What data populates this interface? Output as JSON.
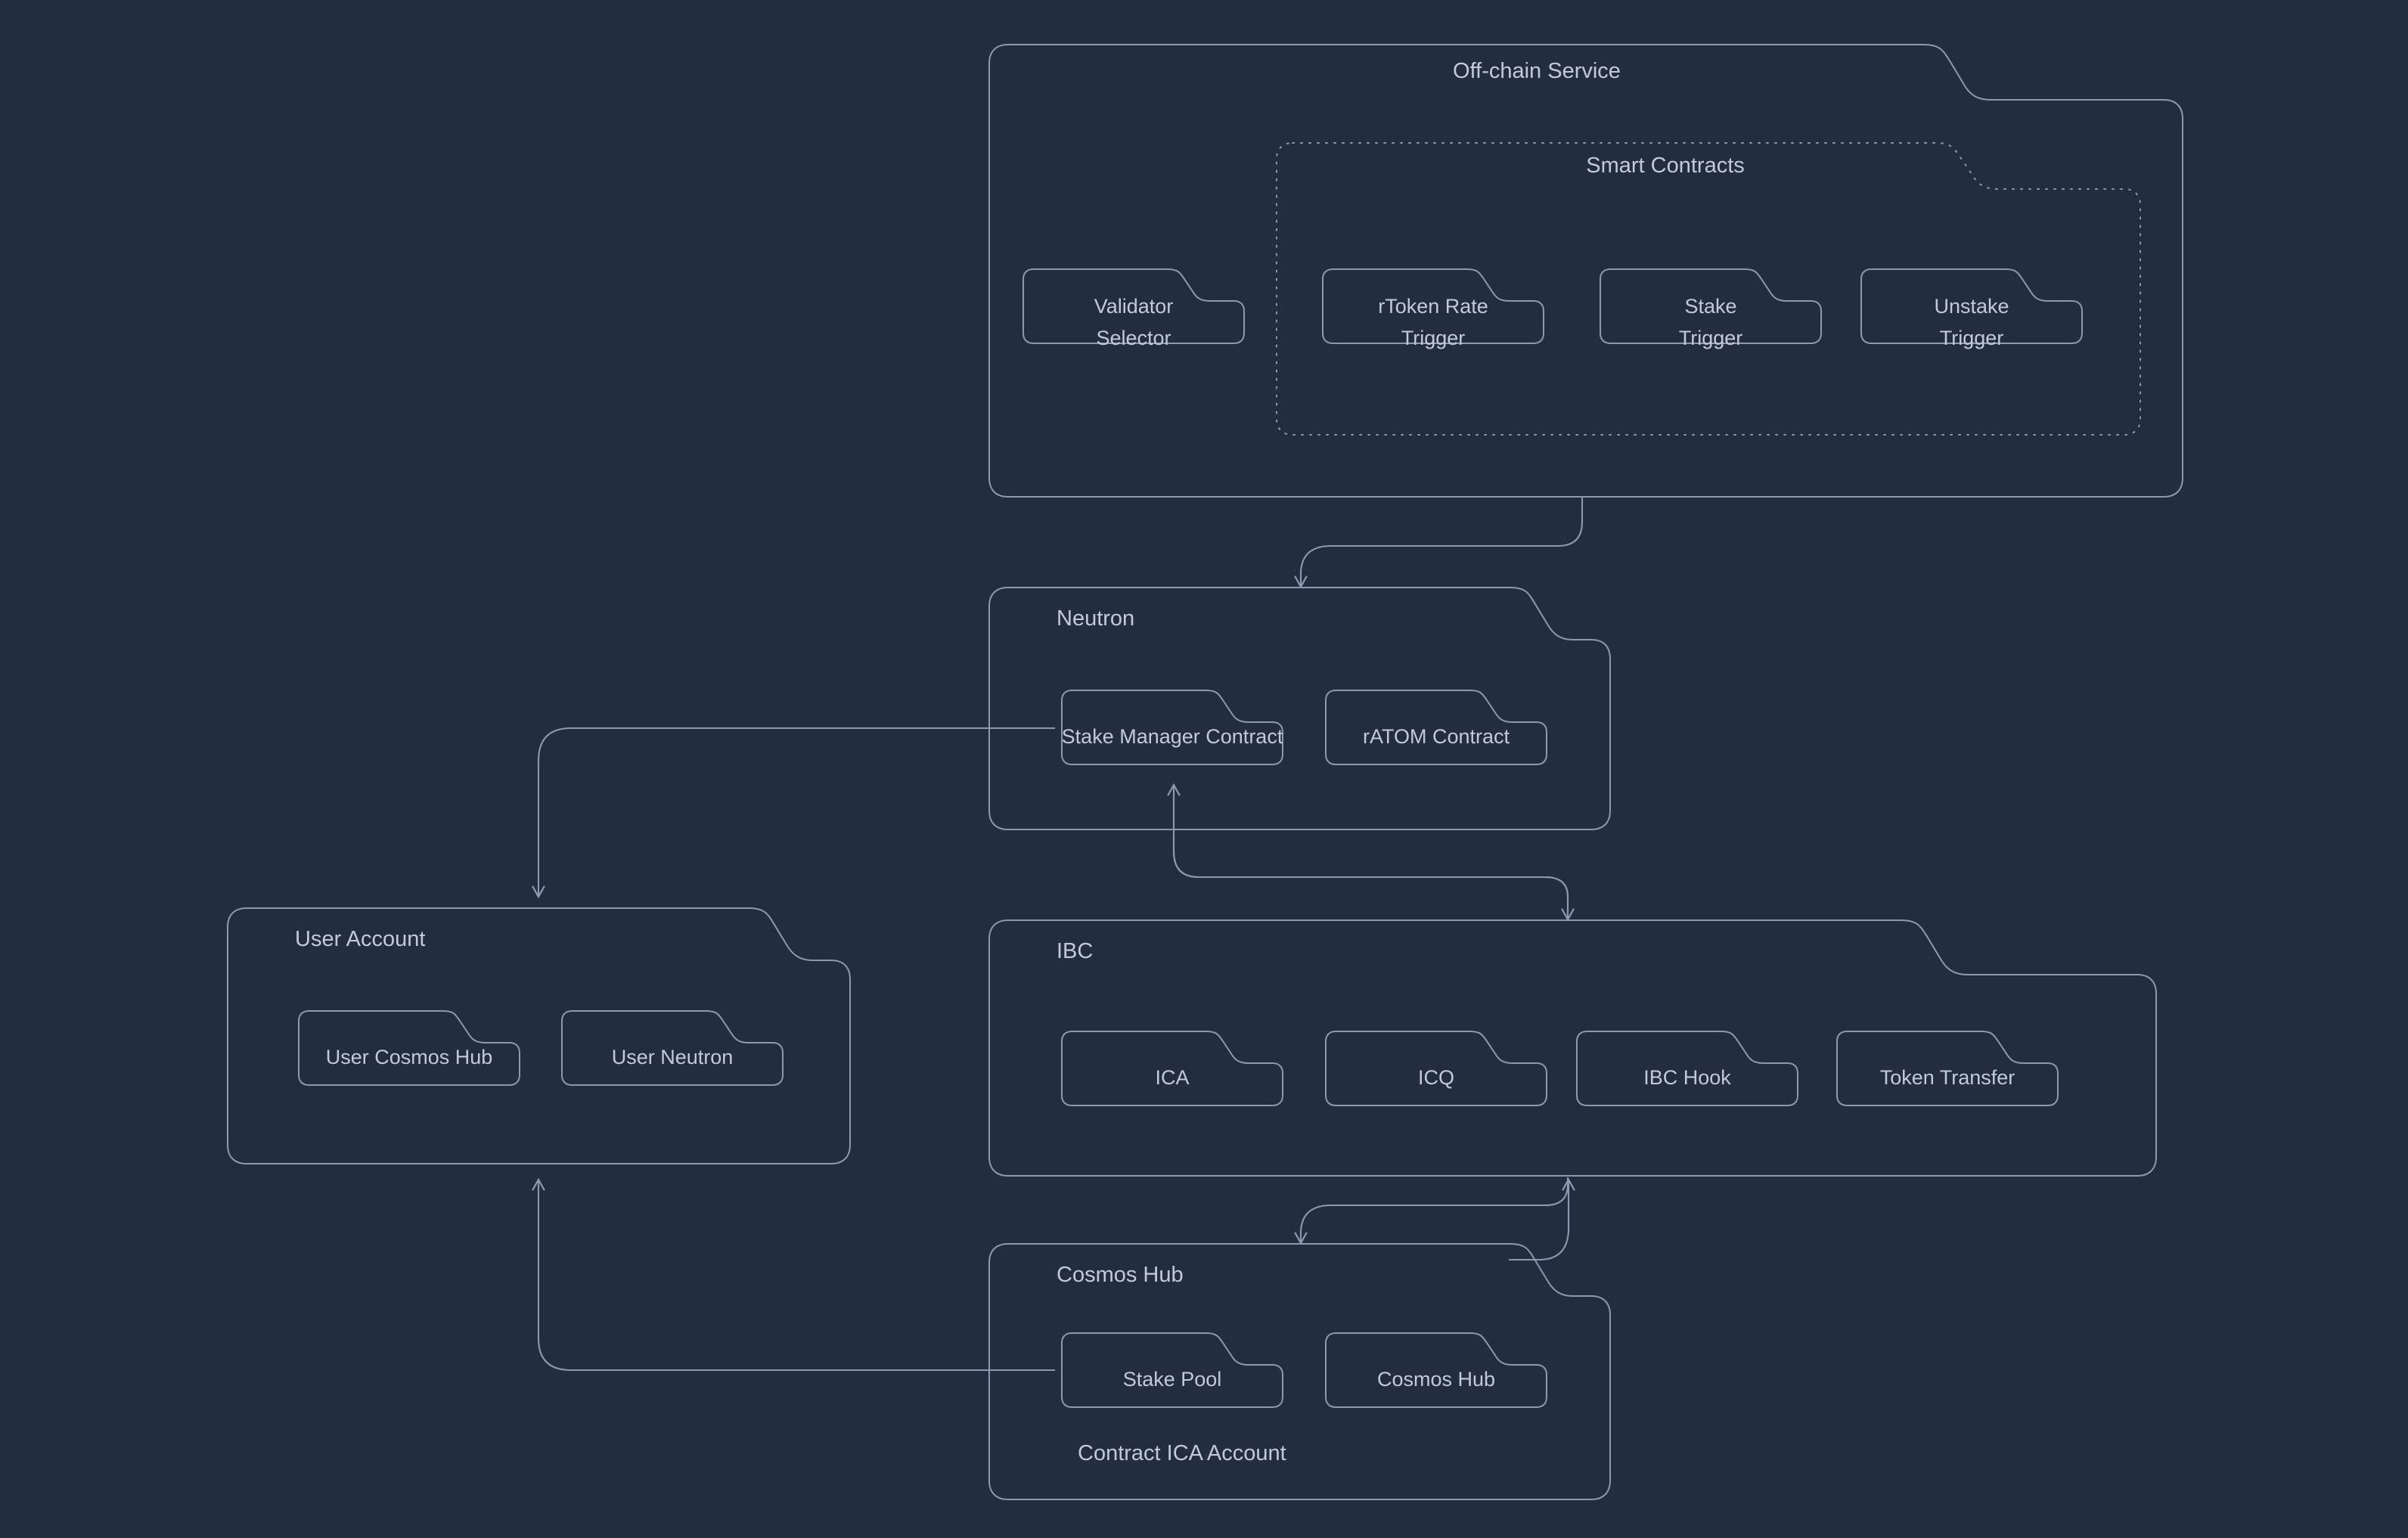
{
  "theme": {
    "background": "#232d40",
    "stroke": "#8d99ad",
    "text": "#c2cada",
    "dotted_stroke": "#8d99ad"
  },
  "diagram": {
    "type": "architecture-diagram",
    "groups": [
      {
        "id": "off-chain-service",
        "title": "Off-chain Service",
        "title_align": "center",
        "children_group": {
          "id": "smart-contracts",
          "title": "Smart Contracts",
          "title_align": "center",
          "border": "dotted",
          "nodes": [
            {
              "id": "rtoken-rate-trigger",
              "label": "rToken Rate\nTrigger"
            },
            {
              "id": "stake-trigger",
              "label": "Stake\nTrigger"
            },
            {
              "id": "unstake-trigger",
              "label": "Unstake\nTrigger"
            }
          ]
        },
        "nodes": [
          {
            "id": "validator-selector",
            "label": "Validator\nSelector"
          }
        ]
      },
      {
        "id": "neutron",
        "title": "Neutron",
        "title_align": "left",
        "nodes": [
          {
            "id": "stake-manager-contract",
            "label": "Stake Manager Contract"
          },
          {
            "id": "ratom-contract",
            "label": "rATOM Contract"
          }
        ]
      },
      {
        "id": "user-account",
        "title": "User Account",
        "title_align": "left",
        "nodes": [
          {
            "id": "user-cosmos-hub",
            "label": "User Cosmos Hub"
          },
          {
            "id": "user-neutron",
            "label": "User Neutron"
          }
        ]
      },
      {
        "id": "ibc",
        "title": "IBC",
        "title_align": "left",
        "nodes": [
          {
            "id": "ica",
            "label": "ICA"
          },
          {
            "id": "icq",
            "label": "ICQ"
          },
          {
            "id": "ibc-hook",
            "label": "IBC Hook"
          },
          {
            "id": "token-transfer",
            "label": "Token Transfer"
          }
        ]
      },
      {
        "id": "cosmos-hub",
        "title": "Cosmos Hub",
        "title_align": "left",
        "footer_label": "Contract ICA Account",
        "nodes": [
          {
            "id": "stake-pool",
            "label": "Stake Pool"
          },
          {
            "id": "cosmos-hub-node",
            "label": "Cosmos Hub"
          }
        ]
      }
    ],
    "edges": [
      {
        "id": "offchain-to-neutron",
        "from": "off-chain-service",
        "to": "neutron",
        "direction": "down"
      },
      {
        "id": "stakemanager-to-userAccount",
        "from": "stake-manager-contract",
        "to": "user-account",
        "direction": "down"
      },
      {
        "id": "left-to-stakemanager",
        "from": "user-account",
        "to": "stake-manager-contract",
        "direction": "right"
      },
      {
        "id": "ibc-to-stakemanager",
        "from": "ibc",
        "to": "stake-manager-contract",
        "direction": "up"
      },
      {
        "id": "neutron-to-ibc",
        "from": "neutron",
        "to": "ibc",
        "direction": "down"
      },
      {
        "id": "ibc-to-cosmoshub",
        "from": "ibc",
        "to": "cosmos-hub",
        "direction": "down"
      },
      {
        "id": "cosmoshub-to-ibc",
        "from": "cosmos-hub",
        "to": "ibc",
        "direction": "up"
      },
      {
        "id": "stakepool-to-useraccount",
        "from": "stake-pool",
        "to": "user-account",
        "direction": "up"
      }
    ]
  }
}
